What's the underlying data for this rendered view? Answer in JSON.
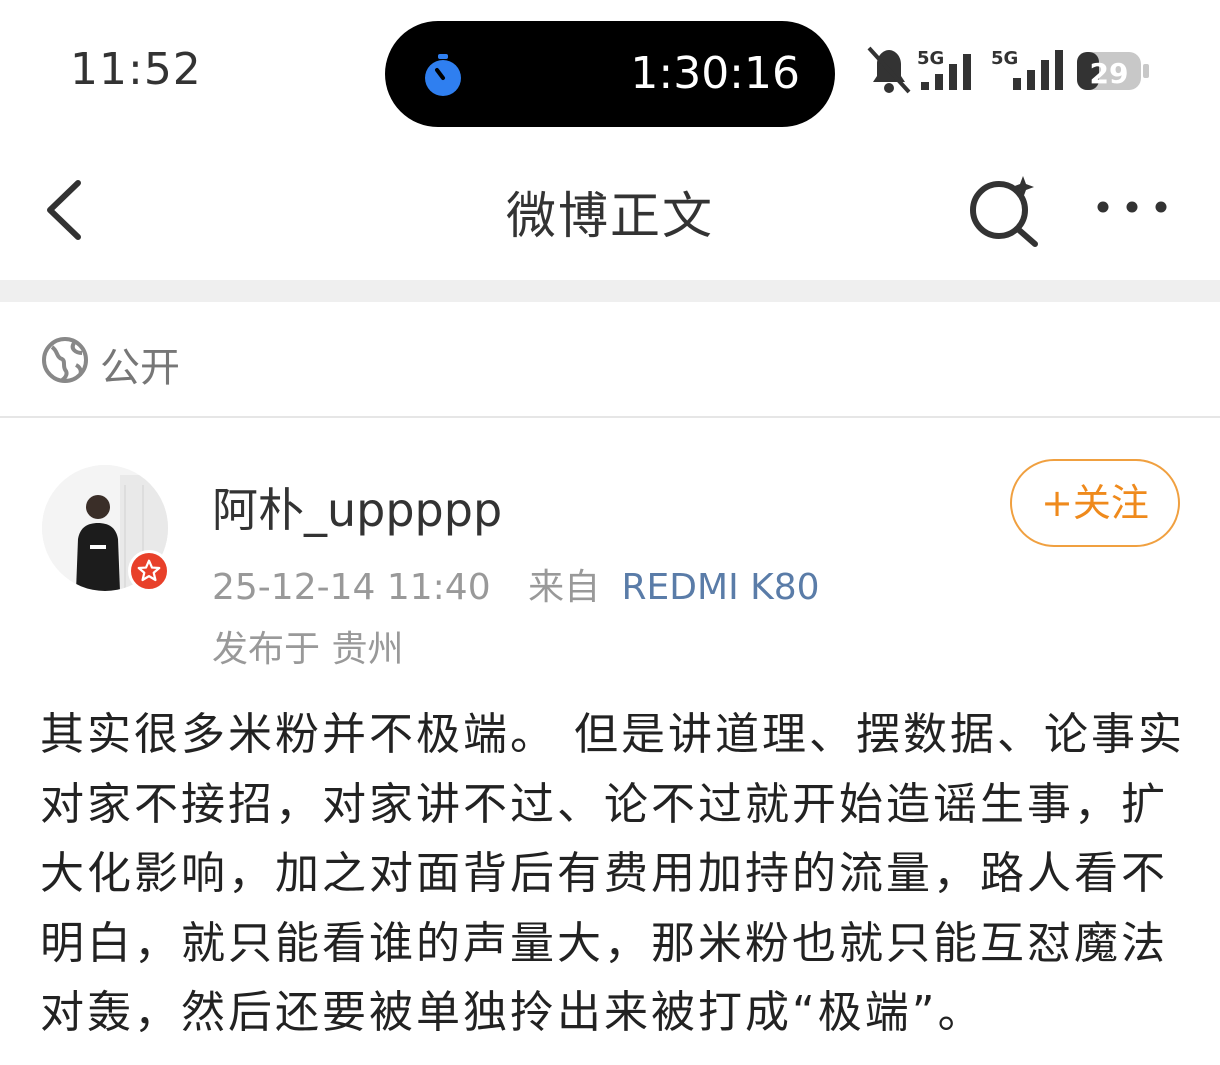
{
  "status_bar": {
    "time": "11:52",
    "timer": "1:30:16",
    "battery": "29"
  },
  "nav": {
    "title": "微博正文"
  },
  "visibility": {
    "label": "公开"
  },
  "post": {
    "author": "阿朴_uppppp",
    "date": "25-12-14 11:40",
    "source_prefix": "来自",
    "device": "REDMI K80",
    "location": "发布于 贵州",
    "follow_label": "+关注",
    "content": "其实很多米粉并不极端。 但是讲道理、摆数据、论事实对家不接招，对家讲不过、论不过就开始造谣生事，扩大化影响，加之对面背后有费用加持的流量，路人看不明白，就只能看谁的声量大，那米粉也就只能互怼魔法对轰，然后还要被单独拎出来被打成“极端”。"
  },
  "colors": {
    "accent": "#ef8a1c",
    "link": "#5a7ca8",
    "badge": "#e8402a"
  }
}
